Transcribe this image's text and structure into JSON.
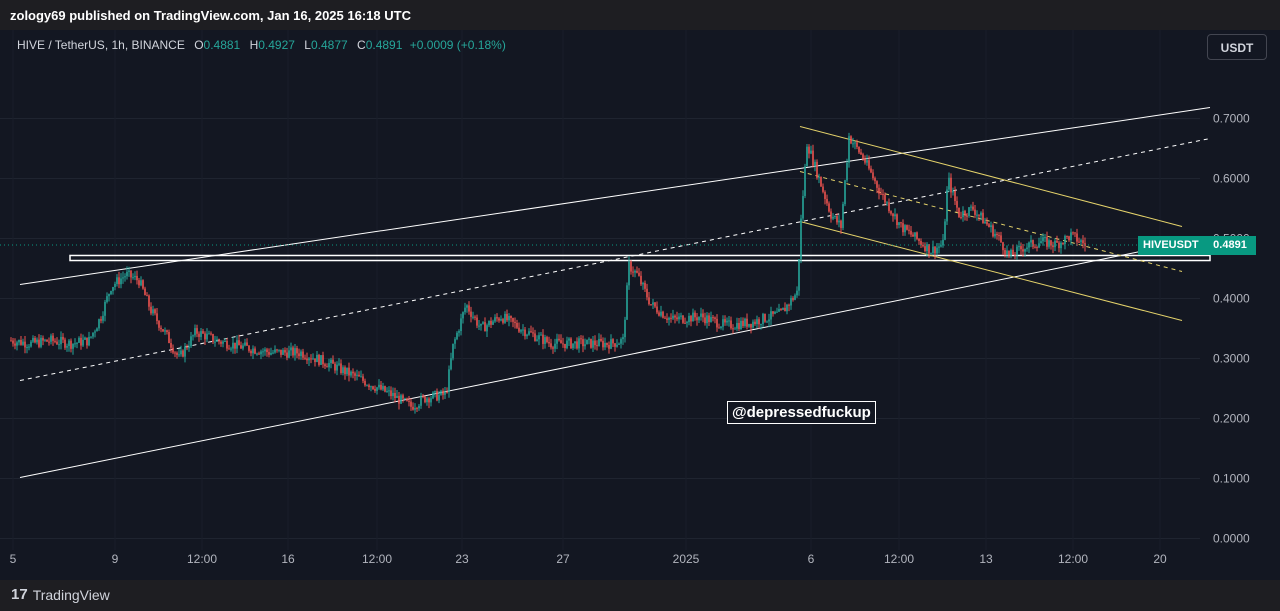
{
  "header": {
    "published_text": "zology69 published on TradingView.com, Jan 16, 2025 16:18 UTC"
  },
  "legend": {
    "symbol": "HIVE / TetherUS, 1h, BINANCE",
    "open_label": "O",
    "open": "0.4881",
    "high_label": "H",
    "high": "0.4927",
    "low_label": "L",
    "low": "0.4877",
    "close_label": "C",
    "close": "0.4891",
    "change": "+0.0009 (+0.18%)"
  },
  "currency_button": "USDT",
  "watermark_text": "@depressedfuckup",
  "last_price": {
    "symbol_tag": "HIVEUSDT",
    "price_tag": "0.4891"
  },
  "footer": {
    "brand": "TradingView",
    "logo_icon": "tradingview-logo-icon"
  },
  "colors": {
    "up": "#26a69a",
    "down": "#ef5350",
    "channel": "#ffffff",
    "wedge": "#e5d36b",
    "price_tag_bg": "#089981",
    "background": "#131722"
  },
  "chart_data": {
    "type": "candlestick",
    "interval": "1h",
    "ylim": [
      0.0,
      0.74
    ],
    "y_ticks": [
      0.0,
      0.1,
      0.2,
      0.3,
      0.4,
      0.5,
      0.6,
      0.7
    ],
    "y_tick_labels": [
      "0.0000",
      "0.1000",
      "0.2000",
      "0.3000",
      "0.4000",
      "0.5000",
      "0.6000",
      "0.7000"
    ],
    "x_tick_labels": [
      "5",
      "9",
      "12:00",
      "16",
      "12:00",
      "23",
      "27",
      "2025",
      "6",
      "12:00",
      "13",
      "12:00",
      "20"
    ],
    "grid": true,
    "last_price": 0.4891,
    "price_path": [
      {
        "t": 0,
        "p": 0.33
      },
      {
        "t": 20,
        "p": 0.325
      },
      {
        "t": 40,
        "p": 0.33
      },
      {
        "t": 60,
        "p": 0.325
      },
      {
        "t": 78,
        "p": 0.33
      },
      {
        "t": 90,
        "p": 0.37
      },
      {
        "t": 100,
        "p": 0.42
      },
      {
        "t": 115,
        "p": 0.44
      },
      {
        "t": 128,
        "p": 0.43
      },
      {
        "t": 140,
        "p": 0.38
      },
      {
        "t": 155,
        "p": 0.34
      },
      {
        "t": 168,
        "p": 0.3
      },
      {
        "t": 185,
        "p": 0.345
      },
      {
        "t": 205,
        "p": 0.33
      },
      {
        "t": 230,
        "p": 0.32
      },
      {
        "t": 260,
        "p": 0.31
      },
      {
        "t": 290,
        "p": 0.31
      },
      {
        "t": 320,
        "p": 0.29
      },
      {
        "t": 350,
        "p": 0.265
      },
      {
        "t": 380,
        "p": 0.24
      },
      {
        "t": 400,
        "p": 0.22
      },
      {
        "t": 415,
        "p": 0.235
      },
      {
        "t": 435,
        "p": 0.24
      },
      {
        "t": 442,
        "p": 0.32
      },
      {
        "t": 455,
        "p": 0.39
      },
      {
        "t": 470,
        "p": 0.35
      },
      {
        "t": 490,
        "p": 0.37
      },
      {
        "t": 515,
        "p": 0.345
      },
      {
        "t": 540,
        "p": 0.325
      },
      {
        "t": 570,
        "p": 0.325
      },
      {
        "t": 600,
        "p": 0.325
      },
      {
        "t": 612,
        "p": 0.33
      },
      {
        "t": 618,
        "p": 0.455
      },
      {
        "t": 626,
        "p": 0.44
      },
      {
        "t": 640,
        "p": 0.39
      },
      {
        "t": 660,
        "p": 0.365
      },
      {
        "t": 690,
        "p": 0.37
      },
      {
        "t": 715,
        "p": 0.355
      },
      {
        "t": 740,
        "p": 0.36
      },
      {
        "t": 770,
        "p": 0.375
      },
      {
        "t": 786,
        "p": 0.41
      },
      {
        "t": 790,
        "p": 0.53
      },
      {
        "t": 796,
        "p": 0.66
      },
      {
        "t": 808,
        "p": 0.6
      },
      {
        "t": 820,
        "p": 0.54
      },
      {
        "t": 830,
        "p": 0.52
      },
      {
        "t": 838,
        "p": 0.67
      },
      {
        "t": 852,
        "p": 0.635
      },
      {
        "t": 870,
        "p": 0.575
      },
      {
        "t": 890,
        "p": 0.52
      },
      {
        "t": 905,
        "p": 0.5
      },
      {
        "t": 920,
        "p": 0.48
      },
      {
        "t": 932,
        "p": 0.49
      },
      {
        "t": 937,
        "p": 0.6
      },
      {
        "t": 948,
        "p": 0.54
      },
      {
        "t": 962,
        "p": 0.55
      },
      {
        "t": 978,
        "p": 0.52
      },
      {
        "t": 988,
        "p": 0.5
      },
      {
        "t": 998,
        "p": 0.47
      },
      {
        "t": 1012,
        "p": 0.485
      },
      {
        "t": 1030,
        "p": 0.495
      },
      {
        "t": 1045,
        "p": 0.49
      },
      {
        "t": 1060,
        "p": 0.505
      },
      {
        "t": 1075,
        "p": 0.489
      }
    ],
    "trendlines": [
      {
        "style": "solid",
        "color": "#ffffff",
        "from": {
          "t": 10,
          "p": 0.4233
        },
        "to": {
          "t": 1200,
          "p": 0.7183
        }
      },
      {
        "style": "dashed",
        "color": "#ffffff",
        "from": {
          "t": 10,
          "p": 0.2633
        },
        "to": {
          "t": 1200,
          "p": 0.6667
        }
      },
      {
        "style": "solid",
        "color": "#ffffff",
        "from": {
          "t": 10,
          "p": 0.1017
        },
        "to": {
          "t": 1200,
          "p": 0.5017
        }
      },
      {
        "style": "solid",
        "color": "#e5d36b",
        "from": {
          "t": 790,
          "p": 0.6867
        },
        "to": {
          "t": 1172,
          "p": 0.52
        }
      },
      {
        "style": "dashed",
        "color": "#e5d36b",
        "from": {
          "t": 790,
          "p": 0.6117
        },
        "to": {
          "t": 1172,
          "p": 0.445
        }
      },
      {
        "style": "solid",
        "color": "#e5d36b",
        "from": {
          "t": 790,
          "p": 0.5283
        },
        "to": {
          "t": 1172,
          "p": 0.3633
        }
      }
    ],
    "horizontal_zone": {
      "from_t": 60,
      "to_t": 1200,
      "top": 0.4717,
      "bottom": 0.4633,
      "color": "#ffffff"
    }
  }
}
